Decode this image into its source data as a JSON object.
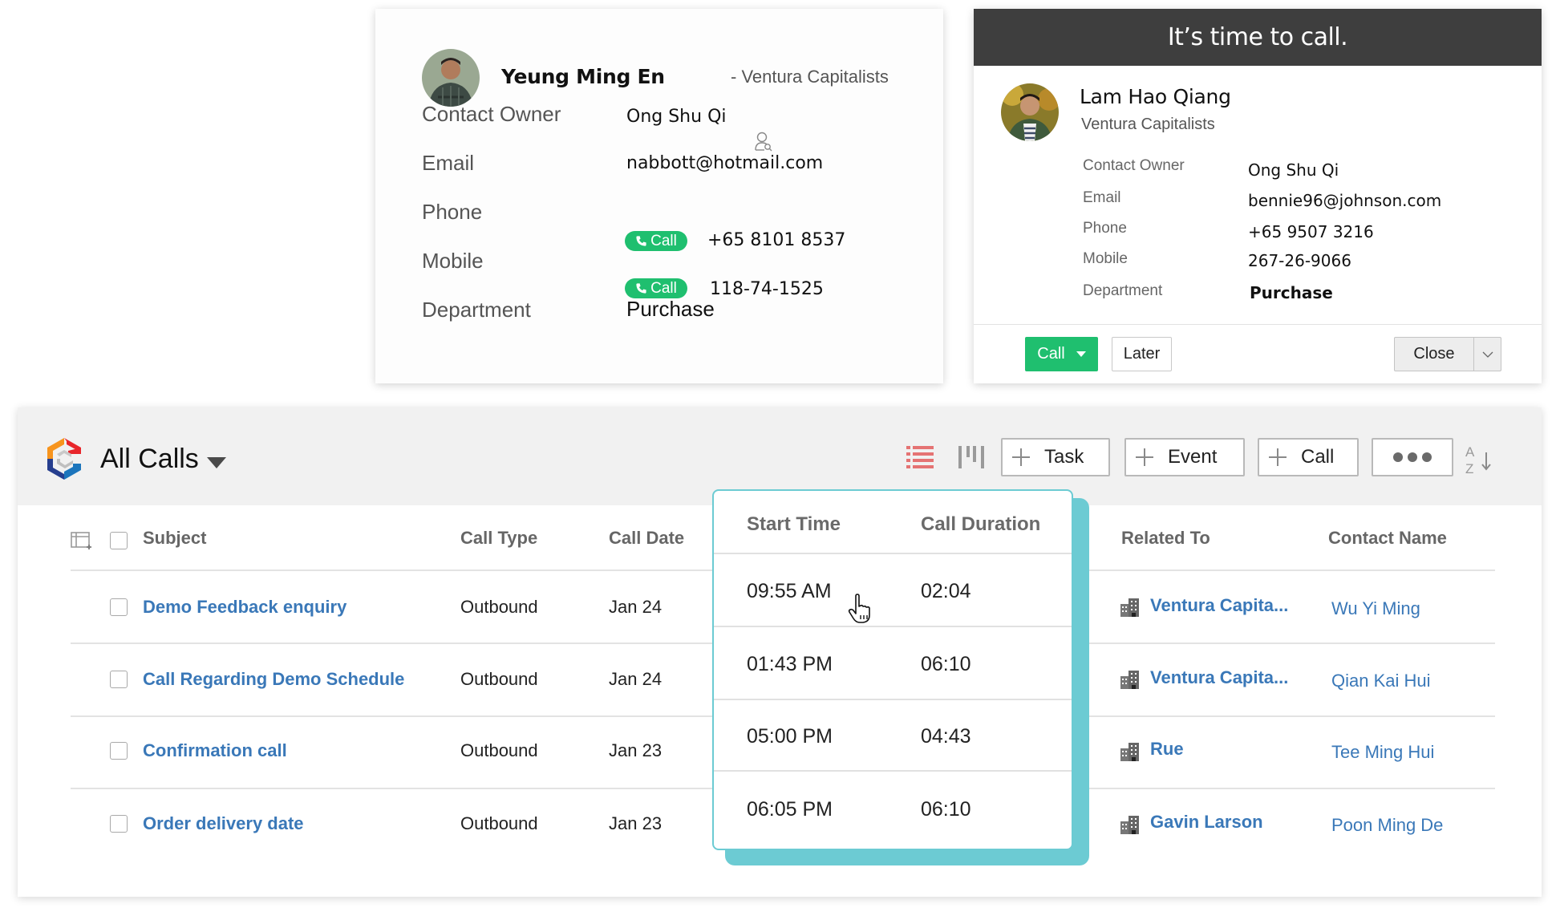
{
  "contact_card": {
    "name": "Yeung Ming En",
    "company": "- Ventura Capitalists",
    "fields": [
      {
        "label": "Contact Owner",
        "value": "Ong Shu Qi"
      },
      {
        "label": "Email",
        "value": "nabbott@hotmail.com"
      },
      {
        "label": "Phone",
        "value": "+65 8101 8537",
        "call_label": "Call"
      },
      {
        "label": "Mobile",
        "value": "118-74-1525",
        "call_label": "Call"
      },
      {
        "label": "Department",
        "value": "Purchase"
      }
    ],
    "icons": {
      "owner": "user-search-icon",
      "call": "phone-icon"
    }
  },
  "call_reminder": {
    "title": "It’s time to call.",
    "name": "Lam Hao Qiang",
    "company": "Ventura Capitalists",
    "fields": [
      {
        "label": "Contact Owner",
        "value": "Ong Shu Qi"
      },
      {
        "label": "Email",
        "value": "bennie96@johnson.com"
      },
      {
        "label": "Phone",
        "value": "+65 9507 3216"
      },
      {
        "label": "Mobile",
        "value": "267-26-9066"
      },
      {
        "label": "Department",
        "value": "Purchase"
      }
    ],
    "buttons": {
      "call": "Call",
      "later": "Later",
      "close": "Close"
    }
  },
  "calls_list": {
    "title": "All Calls",
    "toolbar": {
      "task": "Task",
      "event": "Event",
      "call": "Call",
      "list_view_icon": "list-view-icon",
      "kanban_view_icon": "kanban-view-icon",
      "more_icon": "more-dots-icon",
      "sort_icon": "sort-az-icon"
    },
    "columns": {
      "subject": "Subject",
      "call_type": "Call Type",
      "call_date": "Call Date",
      "start_time": "Start Time",
      "call_duration": "Call Duration",
      "related_to": "Related To",
      "contact_name": "Contact Name"
    },
    "rows": [
      {
        "subject": "Demo Feedback enquiry",
        "call_type": "Outbound",
        "call_date": "Jan 24",
        "start_time": "09:55 AM",
        "call_duration": "02:04",
        "related_to": "Ventura Capita...",
        "contact_name": "Wu Yi Ming"
      },
      {
        "subject": "Call Regarding Demo Schedule",
        "call_type": "Outbound",
        "call_date": "Jan 24",
        "start_time": "01:43 PM",
        "call_duration": "06:10",
        "related_to": "Ventura Capita...",
        "contact_name": "Qian Kai Hui"
      },
      {
        "subject": "Confirmation call",
        "call_type": "Outbound",
        "call_date": "Jan 23",
        "start_time": "05:00 PM",
        "call_duration": "04:43",
        "related_to": "Rue",
        "contact_name": "Tee Ming Hui"
      },
      {
        "subject": "Order delivery date",
        "call_type": "Outbound",
        "call_date": "Jan 23",
        "start_time": "06:05 PM",
        "call_duration": "06:10",
        "related_to": "Gavin Larson",
        "contact_name": "Poon Ming De"
      }
    ]
  },
  "colors": {
    "call_green": "#1fbf6f",
    "link_blue": "#3a78b8",
    "highlight_teal": "#6ccbd3",
    "header_dark": "#3e3e3e",
    "list_view_red": "#e57373"
  }
}
